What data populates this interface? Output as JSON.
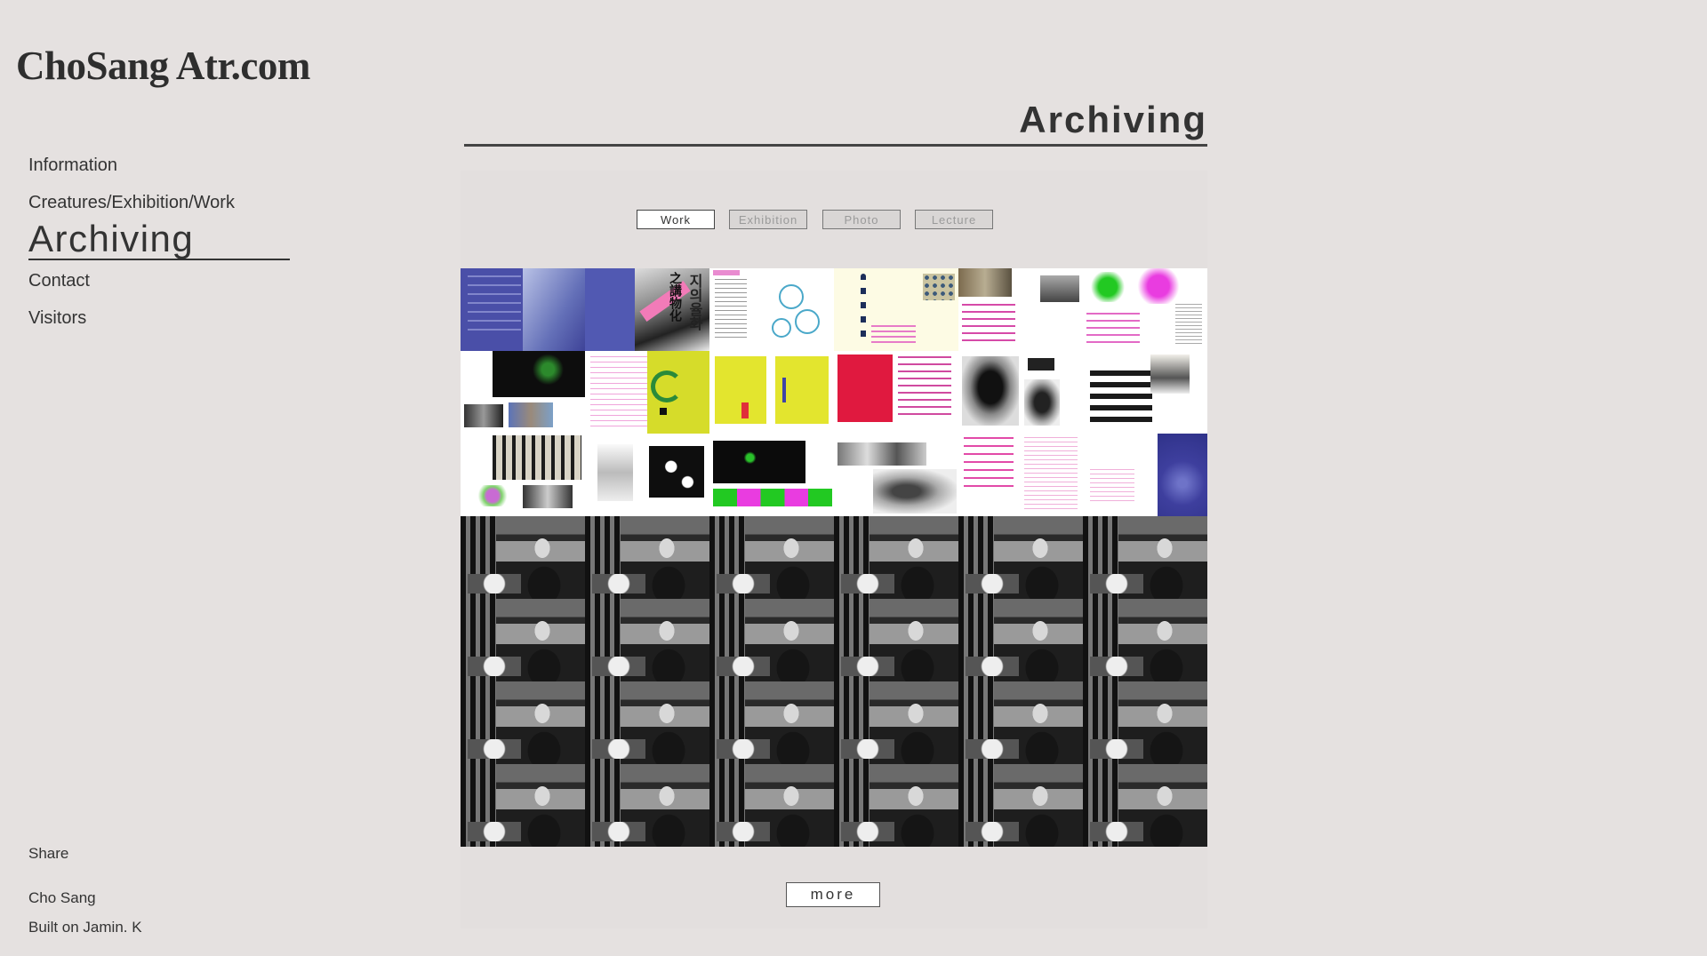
{
  "site": {
    "logo": "ChoSang Atr.com"
  },
  "nav": {
    "items": [
      "Information",
      "Creatures/Exhibition/Work",
      "Archiving",
      "Contact",
      "Visitors"
    ],
    "active": "Archiving"
  },
  "page": {
    "title": "Archiving"
  },
  "filters": [
    "Work",
    "Exhibition",
    "Photo",
    "Lecture"
  ],
  "active_filter": "Work",
  "thumbnails": {
    "rows_of_artwork": 3,
    "rows_of_photos": 4,
    "columns": 6,
    "artwork_text": {
      "vertical_korean": "지의율화",
      "vertical_hanja": "之講物化"
    }
  },
  "more_label": "more",
  "footer": {
    "share": "Share",
    "author": "Cho Sang",
    "built": "Built on Jamin. K"
  },
  "colors": {
    "background": "#e5e1e0",
    "text": "#333333",
    "accent_blue": "#4a4fa8",
    "accent_yellow": "#d9dd2a",
    "accent_red": "#e0193f",
    "accent_pink": "#e63bd8",
    "accent_green": "#2bd02b"
  }
}
